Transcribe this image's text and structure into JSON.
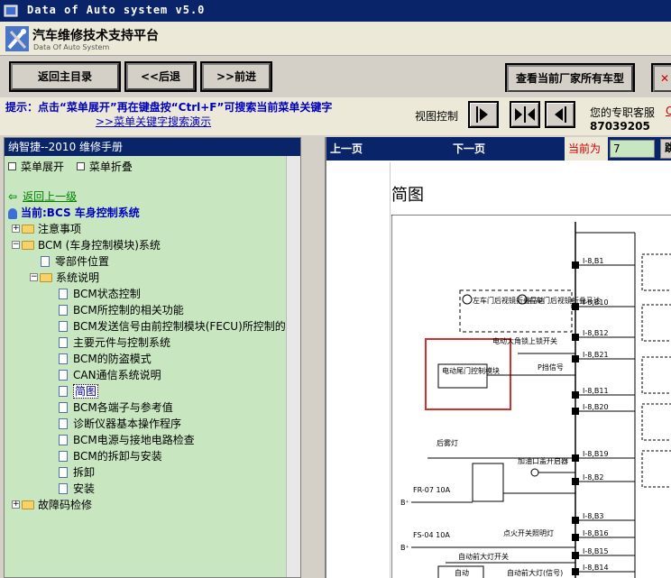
{
  "window": {
    "title": "Data of Auto system v5.0"
  },
  "header": {
    "title_cn": "汽车维修技术支持平台",
    "title_en": "Data Of Auto System"
  },
  "toolbar": {
    "home": "返回主目录",
    "back": "<<后退",
    "forward": ">>前进",
    "all_models": "查看当前厂家所有车型",
    "close": "✕"
  },
  "hintbar": {
    "hint": "提示：点击“菜单展开”再在键盘按“Ctrl+F”可搜索当前菜单关键字",
    "link": ">>菜单关键字搜索演示",
    "view_label": "视图控制",
    "support_label": "您的专职客服",
    "support_link": "Q",
    "support_phone": "87039205"
  },
  "left": {
    "header": "纳智捷--2010 维修手册",
    "expand": "菜单展开",
    "collapse": "菜单折叠",
    "back_up": "返回上一级",
    "current": "当前:BCS 车身控制系统",
    "tree": [
      {
        "label": "注意事项",
        "level": 0,
        "type": "folder",
        "toggle": "+"
      },
      {
        "label": "BCM (车身控制模块)系统",
        "level": 0,
        "type": "folder",
        "toggle": "−"
      },
      {
        "label": "零部件位置",
        "level": 1,
        "type": "doc"
      },
      {
        "label": "系统说明",
        "level": 1,
        "type": "folder",
        "toggle": "−"
      },
      {
        "label": "BCM状态控制",
        "level": 2,
        "type": "doc"
      },
      {
        "label": "BCM所控制的相关功能",
        "level": 2,
        "type": "doc"
      },
      {
        "label": "BCM发送信号由前控制模块(FECU)所控制的相关",
        "level": 2,
        "type": "doc"
      },
      {
        "label": "主要元件与控制系统",
        "level": 2,
        "type": "doc"
      },
      {
        "label": "BCM的防盗模式",
        "level": 2,
        "type": "doc"
      },
      {
        "label": "CAN通信系统说明",
        "level": 2,
        "type": "doc"
      },
      {
        "label": "简图",
        "level": 2,
        "type": "doc",
        "selected": true
      },
      {
        "label": "BCM各端子与参考值",
        "level": 2,
        "type": "doc"
      },
      {
        "label": "诊断仪器基本操作程序",
        "level": 2,
        "type": "doc"
      },
      {
        "label": "BCM电源与接地电路检查",
        "level": 2,
        "type": "doc"
      },
      {
        "label": "BCM的拆卸与安装",
        "level": 2,
        "type": "doc"
      },
      {
        "label": "拆卸",
        "level": 2,
        "type": "doc"
      },
      {
        "label": "安装",
        "level": 2,
        "type": "doc"
      },
      {
        "label": "故障码检修",
        "level": 0,
        "type": "folder",
        "toggle": "+"
      }
    ]
  },
  "right": {
    "prev": "上一页",
    "next": "下一页",
    "current_label": "当前为",
    "page_value": "7",
    "go": "跳",
    "diagram_title": "简图",
    "diagram": {
      "mirror_motor_left": "左车门后视镜折叠马达",
      "mirror_motor_right": "右车门后视镜折叠马达",
      "tailgate_module": "电动尾门控制模块",
      "switch_angle": "电动大角锁上锁开关",
      "p_signal": "P挡信号",
      "fuel_lamp": "后雾灯",
      "fuel_door": "加油口盖开启器",
      "fuse1": "FR-07 10A",
      "fuse2": "FS-04 10A",
      "ignition_lamp": "点火开关照明灯",
      "auto_headlamp_switch": "自动前大灯开关",
      "auto_headlamp_signal": "自动前大灯(信号)",
      "auto_text": "自动",
      "pins": [
        "I-8,B1",
        "I-8,B10",
        "I-8,B12",
        "I-8,B21",
        "I-8,B11",
        "I-8,B20",
        "I-8,B19",
        "I-8,B2",
        "I-8,B3",
        "I-8,B16",
        "I-8,B15",
        "I-8,B14"
      ],
      "b_plus": "B⁺"
    }
  }
}
